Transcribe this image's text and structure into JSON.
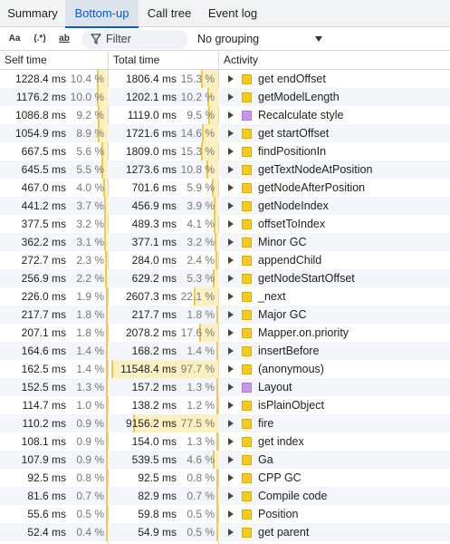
{
  "tabs": [
    {
      "label": "Summary",
      "active": false
    },
    {
      "label": "Bottom-up",
      "active": true
    },
    {
      "label": "Call tree",
      "active": false
    },
    {
      "label": "Event log",
      "active": false
    }
  ],
  "toolbar": {
    "match_case_label": "Aa",
    "regex_label": "(.*)",
    "whole_word_label": "ab",
    "filter_placeholder": "Filter",
    "grouping_value": "No grouping"
  },
  "columns": {
    "self_time": "Self time",
    "total_time": "Total time",
    "activity": "Activity"
  },
  "colors": {
    "scripting": "#f8ca1a",
    "rendering": "#c794f0",
    "bar_fill": "#fdf0c0",
    "bar_edge": "#f2c94c",
    "accent": "#0b57d0"
  },
  "rows": [
    {
      "self": "1228.4 ms",
      "self_pct": "10.4 %",
      "self_frac": 0.104,
      "total": "1806.4 ms",
      "total_pct": "15.3 %",
      "total_frac": 0.153,
      "activity": "get endOffset",
      "category": "scripting"
    },
    {
      "self": "1176.2 ms",
      "self_pct": "10.0 %",
      "self_frac": 0.1,
      "total": "1202.1 ms",
      "total_pct": "10.2 %",
      "total_frac": 0.102,
      "activity": "getModelLength",
      "category": "scripting"
    },
    {
      "self": "1086.8 ms",
      "self_pct": "9.2 %",
      "self_frac": 0.092,
      "total": "1119.0 ms",
      "total_pct": "9.5 %",
      "total_frac": 0.095,
      "activity": "Recalculate style",
      "category": "rendering"
    },
    {
      "self": "1054.9 ms",
      "self_pct": "8.9 %",
      "self_frac": 0.089,
      "total": "1721.6 ms",
      "total_pct": "14.6 %",
      "total_frac": 0.146,
      "activity": "get startOffset",
      "category": "scripting"
    },
    {
      "self": "667.5 ms",
      "self_pct": "5.6 %",
      "self_frac": 0.056,
      "total": "1809.0 ms",
      "total_pct": "15.3 %",
      "total_frac": 0.153,
      "activity": "findPositionIn",
      "category": "scripting"
    },
    {
      "self": "645.5 ms",
      "self_pct": "5.5 %",
      "self_frac": 0.055,
      "total": "1273.6 ms",
      "total_pct": "10.8 %",
      "total_frac": 0.108,
      "activity": "getTextNodeAtPosition",
      "category": "scripting"
    },
    {
      "self": "467.0 ms",
      "self_pct": "4.0 %",
      "self_frac": 0.04,
      "total": "701.6 ms",
      "total_pct": "5.9 %",
      "total_frac": 0.059,
      "activity": "getNodeAfterPosition",
      "category": "scripting"
    },
    {
      "self": "441.2 ms",
      "self_pct": "3.7 %",
      "self_frac": 0.037,
      "total": "456.9 ms",
      "total_pct": "3.9 %",
      "total_frac": 0.039,
      "activity": "getNodeIndex",
      "category": "scripting"
    },
    {
      "self": "377.5 ms",
      "self_pct": "3.2 %",
      "self_frac": 0.032,
      "total": "489.3 ms",
      "total_pct": "4.1 %",
      "total_frac": 0.041,
      "activity": "offsetToIndex",
      "category": "scripting"
    },
    {
      "self": "362.2 ms",
      "self_pct": "3.1 %",
      "self_frac": 0.031,
      "total": "377.1 ms",
      "total_pct": "3.2 %",
      "total_frac": 0.032,
      "activity": "Minor GC",
      "category": "scripting"
    },
    {
      "self": "272.7 ms",
      "self_pct": "2.3 %",
      "self_frac": 0.023,
      "total": "284.0 ms",
      "total_pct": "2.4 %",
      "total_frac": 0.024,
      "activity": "appendChild",
      "category": "scripting"
    },
    {
      "self": "256.9 ms",
      "self_pct": "2.2 %",
      "self_frac": 0.022,
      "total": "629.2 ms",
      "total_pct": "5.3 %",
      "total_frac": 0.053,
      "activity": "getNodeStartOffset",
      "category": "scripting"
    },
    {
      "self": "226.0 ms",
      "self_pct": "1.9 %",
      "self_frac": 0.019,
      "total": "2607.3 ms",
      "total_pct": "22.1 %",
      "total_frac": 0.221,
      "activity": "_next",
      "category": "scripting"
    },
    {
      "self": "217.7 ms",
      "self_pct": "1.8 %",
      "self_frac": 0.018,
      "total": "217.7 ms",
      "total_pct": "1.8 %",
      "total_frac": 0.018,
      "activity": "Major GC",
      "category": "scripting"
    },
    {
      "self": "207.1 ms",
      "self_pct": "1.8 %",
      "self_frac": 0.018,
      "total": "2078.2 ms",
      "total_pct": "17.6 %",
      "total_frac": 0.176,
      "activity": "Mapper.on.priority",
      "category": "scripting"
    },
    {
      "self": "164.6 ms",
      "self_pct": "1.4 %",
      "self_frac": 0.014,
      "total": "168.2 ms",
      "total_pct": "1.4 %",
      "total_frac": 0.014,
      "activity": "insertBefore",
      "category": "scripting"
    },
    {
      "self": "162.5 ms",
      "self_pct": "1.4 %",
      "self_frac": 0.014,
      "total": "11548.4 ms",
      "total_pct": "97.7 %",
      "total_frac": 0.977,
      "activity": "(anonymous)",
      "category": "scripting"
    },
    {
      "self": "152.5 ms",
      "self_pct": "1.3 %",
      "self_frac": 0.013,
      "total": "157.2 ms",
      "total_pct": "1.3 %",
      "total_frac": 0.013,
      "activity": "Layout",
      "category": "rendering"
    },
    {
      "self": "114.7 ms",
      "self_pct": "1.0 %",
      "self_frac": 0.01,
      "total": "138.2 ms",
      "total_pct": "1.2 %",
      "total_frac": 0.012,
      "activity": "isPlainObject",
      "category": "scripting"
    },
    {
      "self": "110.2 ms",
      "self_pct": "0.9 %",
      "self_frac": 0.009,
      "total": "9156.2 ms",
      "total_pct": "77.5 %",
      "total_frac": 0.775,
      "activity": "fire",
      "category": "scripting"
    },
    {
      "self": "108.1 ms",
      "self_pct": "0.9 %",
      "self_frac": 0.009,
      "total": "154.0 ms",
      "total_pct": "1.3 %",
      "total_frac": 0.013,
      "activity": "get index",
      "category": "scripting"
    },
    {
      "self": "107.9 ms",
      "self_pct": "0.9 %",
      "self_frac": 0.009,
      "total": "539.5 ms",
      "total_pct": "4.6 %",
      "total_frac": 0.046,
      "activity": "Ga",
      "category": "scripting"
    },
    {
      "self": "92.5 ms",
      "self_pct": "0.8 %",
      "self_frac": 0.008,
      "total": "92.5 ms",
      "total_pct": "0.8 %",
      "total_frac": 0.008,
      "activity": "CPP GC",
      "category": "scripting"
    },
    {
      "self": "81.6 ms",
      "self_pct": "0.7 %",
      "self_frac": 0.007,
      "total": "82.9 ms",
      "total_pct": "0.7 %",
      "total_frac": 0.007,
      "activity": "Compile code",
      "category": "scripting"
    },
    {
      "self": "55.6 ms",
      "self_pct": "0.5 %",
      "self_frac": 0.005,
      "total": "59.8 ms",
      "total_pct": "0.5 %",
      "total_frac": 0.005,
      "activity": "Position",
      "category": "scripting"
    },
    {
      "self": "52.4 ms",
      "self_pct": "0.4 %",
      "self_frac": 0.004,
      "total": "54.9 ms",
      "total_pct": "0.5 %",
      "total_frac": 0.005,
      "activity": "get parent",
      "category": "scripting"
    }
  ]
}
